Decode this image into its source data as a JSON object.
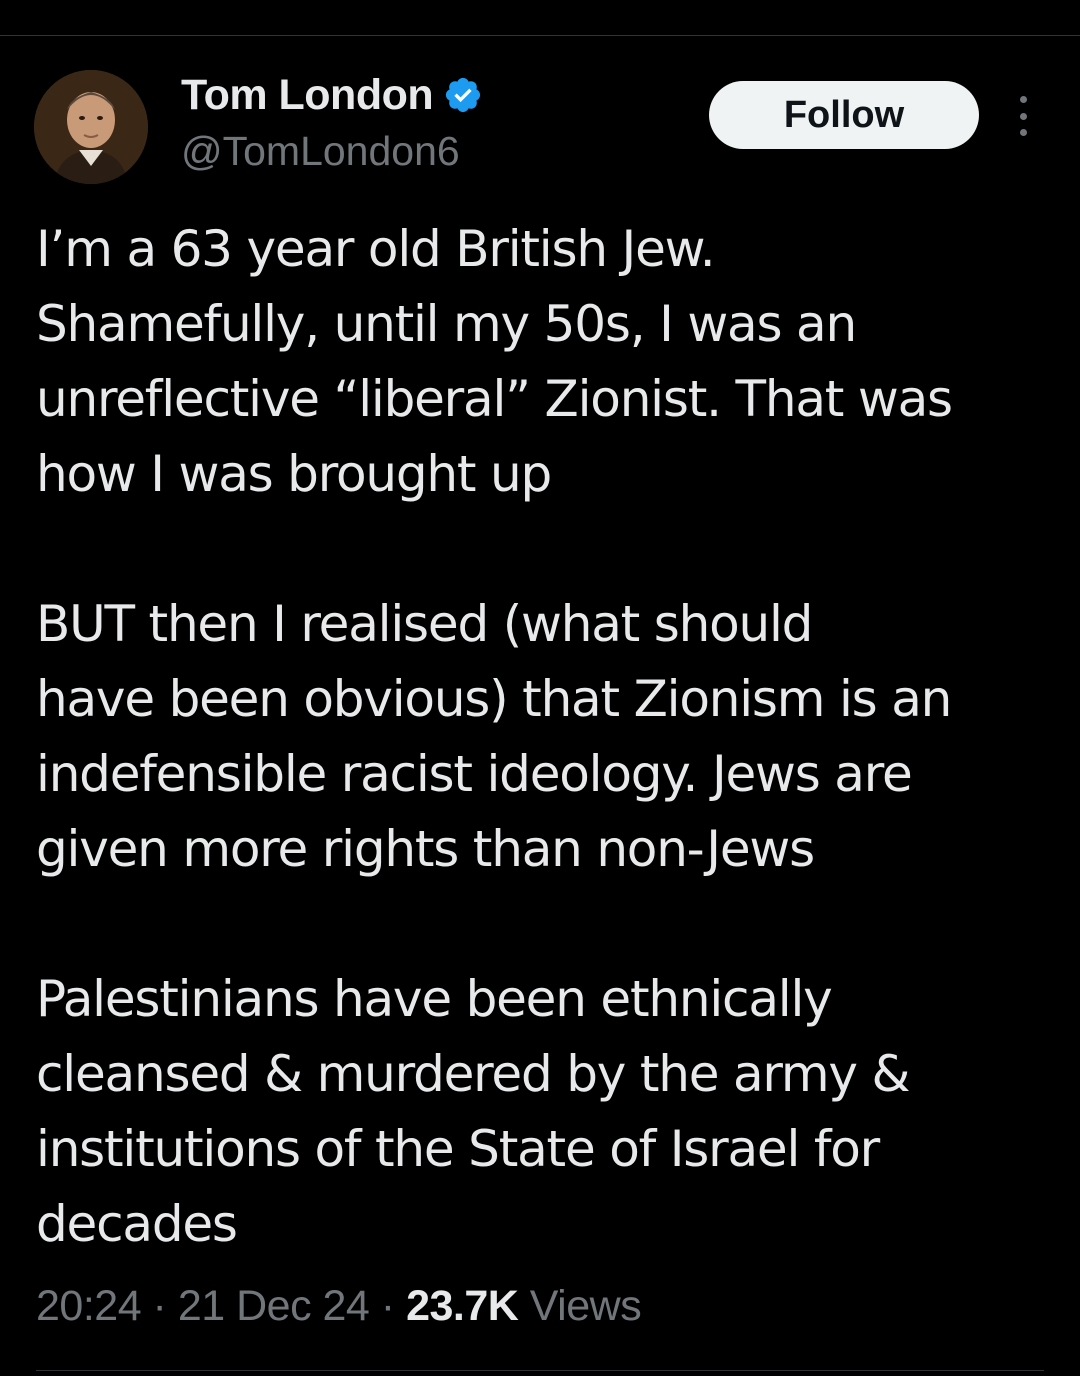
{
  "author": {
    "display_name": "Tom London",
    "handle": "@TomLondon6",
    "verified": true
  },
  "actions": {
    "follow_label": "Follow"
  },
  "tweet": {
    "lines": [
      "I’m a 63 year old British Jew.",
      "Shamefully, until my 50s, I was an",
      "unreflective “liberal” Zionist. That was",
      "how I was brought up",
      "",
      "BUT then I realised (what should",
      "have been obvious) that Zionism is an",
      "indefensible racist ideology. Jews are",
      "given more rights than non-Jews",
      "",
      "Palestinians have been ethnically",
      "cleansed & murdered by the army &",
      "institutions of the State of Israel for",
      "decades"
    ]
  },
  "meta": {
    "time": "20:24",
    "separator": " · ",
    "date": "21 Dec 24",
    "views_count": "23.7K",
    "views_label": " Views"
  },
  "colors": {
    "background": "#000000",
    "text_primary": "#e7e9ea",
    "text_secondary": "#71767b",
    "verified_blue": "#1d9bf0",
    "follow_bg": "#eff3f4"
  }
}
